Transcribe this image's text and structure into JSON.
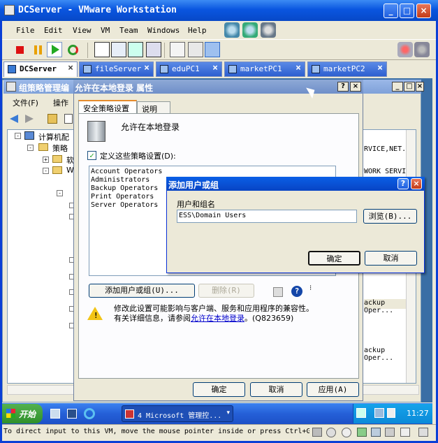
{
  "window": {
    "title": "DCServer - VMware Workstation"
  },
  "menu": [
    "File",
    "Edit",
    "View",
    "VM",
    "Team",
    "Windows",
    "Help"
  ],
  "tabs": [
    {
      "label": "DCServer",
      "active": true
    },
    {
      "label": "fileServer",
      "active": false
    },
    {
      "label": "eduPC1",
      "active": false
    },
    {
      "label": "marketPC1",
      "active": false
    },
    {
      "label": "marketPC2",
      "active": false
    }
  ],
  "gpm": {
    "title": "组策略管理编",
    "menu": [
      "文件(F)",
      "操作"
    ],
    "tree": [
      "计算机配",
      "策略",
      "软",
      "W"
    ],
    "right_col": [
      "RVICE,NET...",
      "WORK SERVICE",
      "ackup Oper...",
      "ackup Oper..."
    ]
  },
  "prop": {
    "title": "允许在本地登录 属性",
    "tabs": [
      "安全策略设置",
      "说明"
    ],
    "policy_name": "允许在本地登录",
    "define_checkbox": "定义这些策略设置(D):",
    "accounts": [
      "Account Operators",
      "Administrators",
      "Backup Operators",
      "Print Operators",
      "Server Operators"
    ],
    "add_button": "添加用户或组(U)...",
    "remove_button": "删除(R)",
    "warning_line1": "修改此设置可能影响与客户端、服务和应用程序的兼容性。",
    "warning_line2_prefix": "有关详细信息，请参阅",
    "warning_link": "允许在本地登录",
    "warning_suffix": "。(Q823659)",
    "ok": "确定",
    "cancel": "取消",
    "apply": "应用(A)"
  },
  "add_dialog": {
    "title": "添加用户或组",
    "field_label": "用户和组名",
    "field_value": "ESS\\Domain Users",
    "browse": "浏览(B)...",
    "ok": "确定",
    "cancel": "取消"
  },
  "taskbar": {
    "start": "开始",
    "task_label": "4 Microsoft 管理控...",
    "clock": "11:27"
  },
  "status_text": "To direct input to this VM, move the mouse pointer inside or press Ctrl+G.",
  "colors": {
    "xp_blue": "#0a56e0",
    "dialog_bg": "#ece9d8",
    "start_green": "#3a9a34"
  }
}
